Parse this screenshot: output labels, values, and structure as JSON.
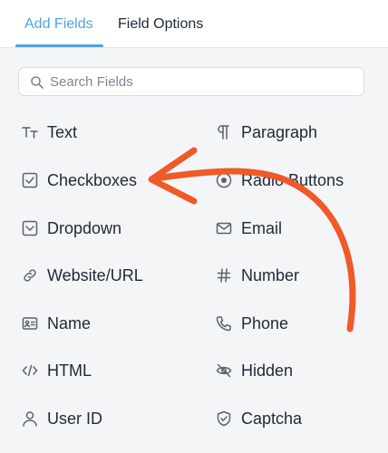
{
  "tabs": {
    "add_fields": "Add Fields",
    "field_options": "Field Options"
  },
  "search": {
    "placeholder": "Search Fields",
    "value": ""
  },
  "fields": {
    "text": "Text",
    "paragraph": "Paragraph",
    "checkboxes": "Checkboxes",
    "radio_buttons": "Radio Buttons",
    "dropdown": "Dropdown",
    "email": "Email",
    "website_url": "Website/URL",
    "number": "Number",
    "name": "Name",
    "phone": "Phone",
    "html": "HTML",
    "hidden": "Hidden",
    "user_id": "User ID",
    "captcha": "Captcha"
  },
  "icons": {
    "text": "text-tt-icon",
    "paragraph": "pilcrow-icon",
    "checkboxes": "checkbox-icon",
    "radio_buttons": "radio-icon",
    "dropdown": "dropdown-icon",
    "email": "envelope-icon",
    "website_url": "link-icon",
    "number": "hash-icon",
    "name": "id-card-icon",
    "phone": "phone-icon",
    "html": "code-icon",
    "hidden": "eye-slash-icon",
    "user_id": "user-icon",
    "captcha": "shield-check-icon"
  },
  "colors": {
    "accent": "#4fa3e6",
    "arrow": "#ef5a28",
    "panel_bg": "#f3f5f7",
    "text": "#1f2937",
    "icon": "#59636e"
  }
}
